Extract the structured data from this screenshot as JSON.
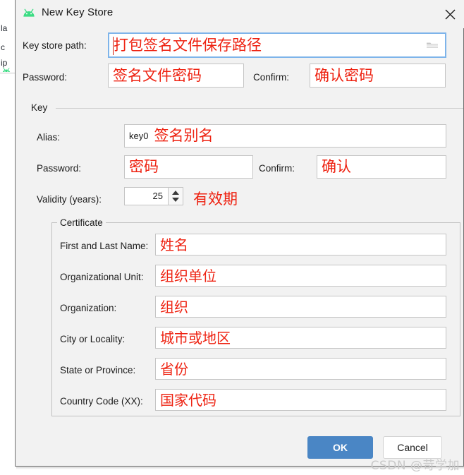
{
  "background": {
    "fragments": [
      "la",
      "c",
      "ip"
    ],
    "icon": "android-robot-icon"
  },
  "dialog": {
    "title": "New Key Store",
    "title_icon": "android-robot-icon",
    "close_icon": "close-icon",
    "keystore": {
      "path_label": "Key store path:",
      "path_value": "打包签名文件保存路径",
      "path_browse_icon": "folder-icon",
      "password_label": "Password:",
      "password_value": "签名文件密码",
      "confirm_label": "Confirm:",
      "confirm_value": "确认密码"
    },
    "key_section": {
      "title": "Key",
      "alias_label": "Alias:",
      "alias_prefix": "key0",
      "alias_value": "签名别名",
      "password_label": "Password:",
      "password_value": "密码",
      "confirm_label": "Confirm:",
      "confirm_value": "确认",
      "validity_label": "Validity (years):",
      "validity_value": "25",
      "validity_annotation": "有效期"
    },
    "certificate": {
      "title": "Certificate",
      "rows": [
        {
          "label": "First and Last Name:",
          "value": "姓名"
        },
        {
          "label": "Organizational Unit:",
          "value": "组织单位"
        },
        {
          "label": "Organization:",
          "value": "组织"
        },
        {
          "label": "City or Locality:",
          "value": "城市或地区"
        },
        {
          "label": "State or Province:",
          "value": "省份"
        },
        {
          "label": "Country Code (XX):",
          "value": "国家代码"
        }
      ]
    },
    "buttons": {
      "ok": "OK",
      "cancel": "Cancel"
    },
    "colors": {
      "annotation_red": "#ee2211",
      "ok_blue": "#4a86c5",
      "android_green": "#3ddc84",
      "focus_blue": "#7eb4ea"
    }
  },
  "watermark": "CSDN @苛学加"
}
